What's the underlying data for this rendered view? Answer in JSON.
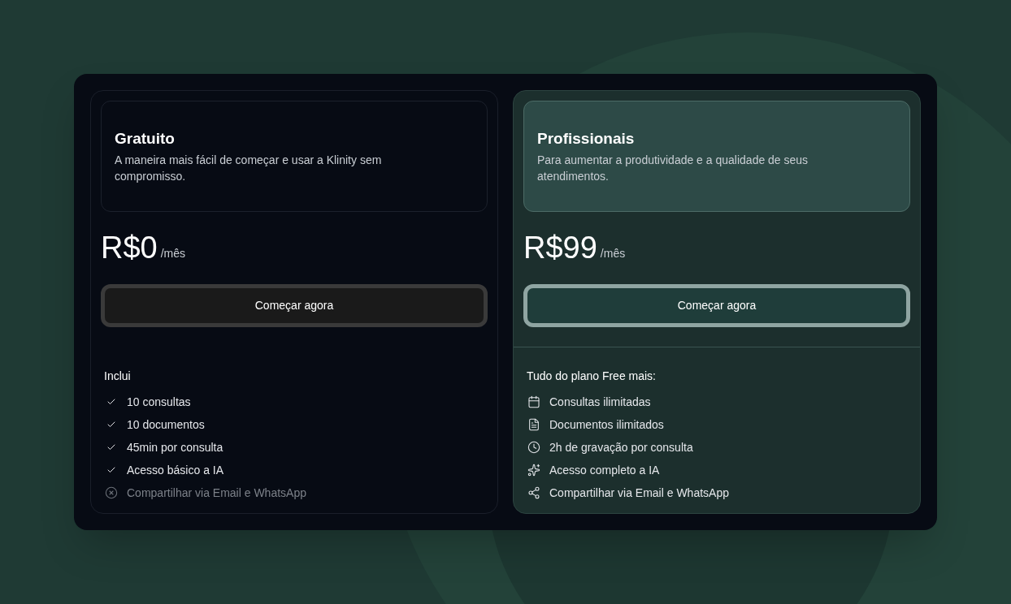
{
  "plans": [
    {
      "kind": "free",
      "name": "Gratuito",
      "description": "A maneira mais fácil de começar e usar a Klinity sem compromisso.",
      "price": "R$0",
      "period": "/mês",
      "button": "Começar agora",
      "features_title": "Inclui",
      "features": [
        {
          "kind": "check",
          "label": "10 consultas",
          "included": true
        },
        {
          "kind": "check",
          "label": "10 documentos",
          "included": true
        },
        {
          "kind": "check",
          "label": "45min por consulta",
          "included": true
        },
        {
          "kind": "check",
          "label": "Acesso básico a IA",
          "included": true
        },
        {
          "kind": "excluded",
          "label": "Compartilhar via Email e WhatsApp",
          "included": false
        }
      ]
    },
    {
      "kind": "pro",
      "name": "Profissionais",
      "description": "Para aumentar a produtividade e a qualidade de seus atendimentos.",
      "price": "R$99",
      "period": "/mês",
      "button": "Começar agora",
      "features_title": "Tudo do plano Free mais:",
      "features": [
        {
          "kind": "calendar",
          "label": "Consultas ilimitadas",
          "included": true
        },
        {
          "kind": "document",
          "label": "Documentos ilimitados",
          "included": true
        },
        {
          "kind": "clock",
          "label": "2h de gravação por consulta",
          "included": true
        },
        {
          "kind": "sparkle",
          "label": "Acesso completo a IA",
          "included": true
        },
        {
          "kind": "share",
          "label": "Compartilhar via Email e WhatsApp",
          "included": true
        }
      ]
    }
  ]
}
